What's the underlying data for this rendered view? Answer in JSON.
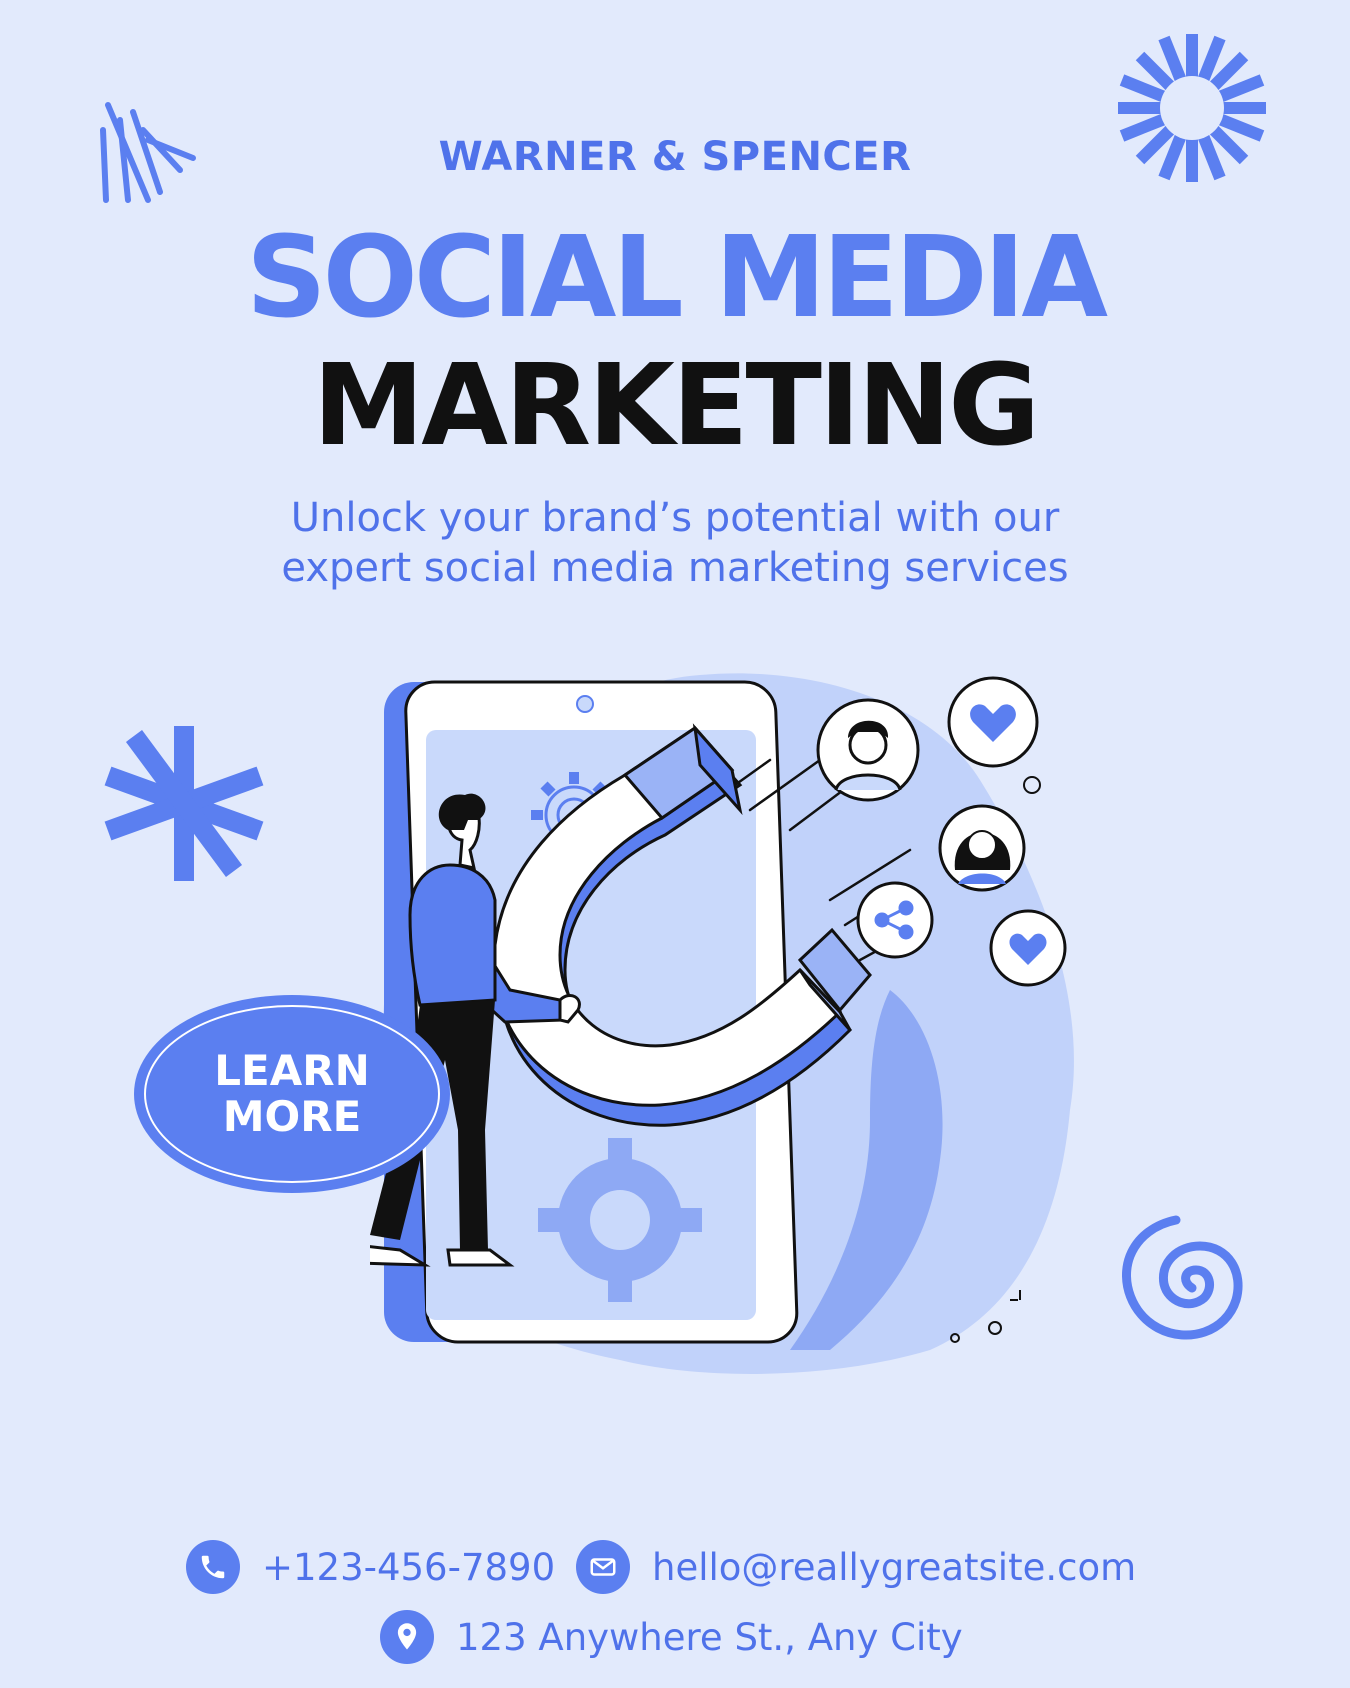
{
  "brand": "WARNER & SPENCER",
  "headline": {
    "line1": "SOCIAL MEDIA",
    "line2": "MARKETING"
  },
  "subtitle": {
    "line1": "Unlock your brand’s potential with our",
    "line2": "expert social media marketing services"
  },
  "cta": {
    "line1": "LEARN",
    "line2": "MORE"
  },
  "contact": {
    "phone": "+123-456-7890",
    "email": "hello@reallygreatsite.com",
    "address": "123 Anywhere St., Any City"
  },
  "icons": [
    "phone-icon",
    "mail-icon",
    "location-pin-icon"
  ],
  "colors": {
    "background": "#e2eafc",
    "accent": "#5b7ff0",
    "dark": "#111111"
  }
}
